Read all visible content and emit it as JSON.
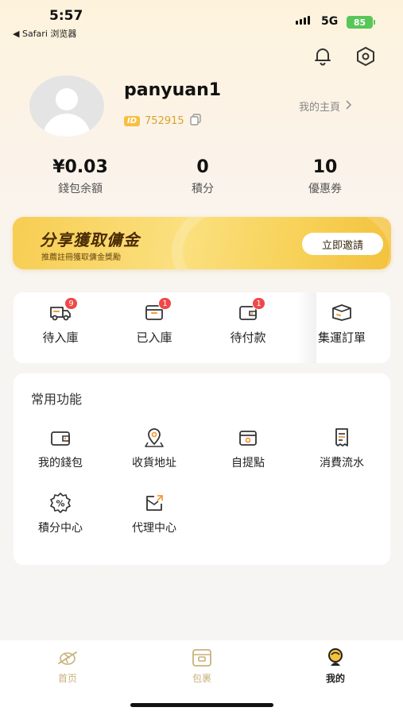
{
  "status_bar": {
    "time": "5:57",
    "back_app": "◀ Safari 浏览器",
    "network": "5G",
    "battery": "85"
  },
  "profile": {
    "username": "panyuan1",
    "id_badge": "ID",
    "id_number": "752915",
    "home_link": "我的主頁"
  },
  "stats": [
    {
      "value": "¥0.03",
      "label": "錢包余額"
    },
    {
      "value": "0",
      "label": "積分"
    },
    {
      "value": "10",
      "label": "優惠券"
    }
  ],
  "banner": {
    "title": "分享獲取傭金",
    "subtitle": "推薦註冊獲取傭金獎勵",
    "button": "立即邀請"
  },
  "orders": [
    {
      "label": "待入庫",
      "badge": "9",
      "icon": "truck-icon"
    },
    {
      "label": "已入庫",
      "badge": "1",
      "icon": "box-icon"
    },
    {
      "label": "待付款",
      "badge": "1",
      "icon": "payment-icon"
    },
    {
      "label": "集運訂單",
      "badge": "",
      "icon": "package-icon"
    }
  ],
  "functions": {
    "title": "常用功能",
    "items": [
      {
        "label": "我的錢包",
        "icon": "wallet-icon"
      },
      {
        "label": "收貨地址",
        "icon": "location-icon"
      },
      {
        "label": "自提點",
        "icon": "store-icon"
      },
      {
        "label": "消費流水",
        "icon": "receipt-icon"
      },
      {
        "label": "積分中心",
        "icon": "percent-icon"
      },
      {
        "label": "代理中心",
        "icon": "share-icon"
      }
    ]
  },
  "tabbar": [
    {
      "label": "首页",
      "icon": "plane-icon",
      "active": false
    },
    {
      "label": "包裹",
      "icon": "parcel-icon",
      "active": false
    },
    {
      "label": "我的",
      "icon": "user-icon",
      "active": true
    }
  ],
  "colors": {
    "accent": "#f6c044",
    "badge": "#f04848",
    "tab_inactive": "#c8b27a",
    "tab_active": "#222222"
  }
}
